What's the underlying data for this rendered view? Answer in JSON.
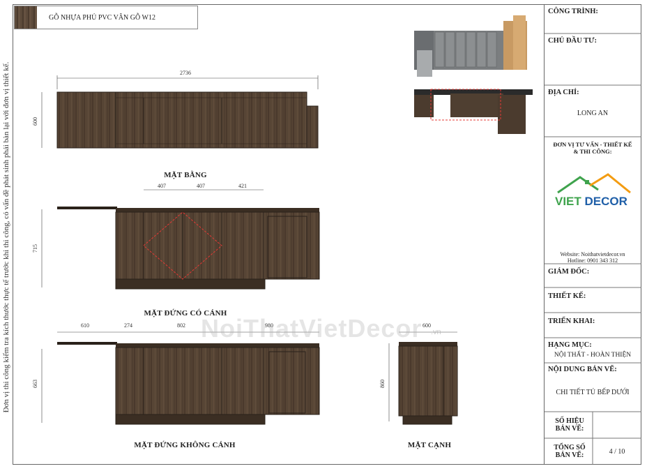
{
  "material": {
    "label": "GỖ NHỰA PHỦ PVC VÂN GỖ W12"
  },
  "side_note": "Đơn vị thi công kiểm tra kích thước thực tế trước khi thi công, có vấn đề phát sinh phải bàn lại với đơn vị thiết kế.",
  "views": {
    "plan": {
      "caption": "MẶT BẰNG",
      "width": "2736",
      "depth": "600"
    },
    "elevation_doors": {
      "caption": "MẶT ĐỨNG CÓ CÁNH",
      "height": "715",
      "widths": [
        "407",
        "407",
        "421"
      ]
    },
    "elevation_no_doors": {
      "caption": "MẶT ĐỨNG KHÔNG CÁNH",
      "height": "663",
      "widths": [
        "610",
        "274",
        "802",
        "980"
      ]
    },
    "side": {
      "caption": "MẶT CẠNH",
      "width": "600",
      "height": "860"
    }
  },
  "watermark": {
    "main": "NoiThatVietDecor",
    "suffix": ".vn"
  },
  "title_block": {
    "project_label": "CÔNG TRÌNH:",
    "investor_label": "CHỦ ĐẦU TƯ:",
    "address_label": "ĐỊA CHỈ:",
    "address_value": "LONG AN",
    "consultant_label": "ĐƠN VỊ TƯ VẤN - THIẾT KẾ & THI CÔNG:",
    "logo": {
      "viet": "VIET",
      "decor": "DECOR"
    },
    "website": "Website: Noithatvietdecor.vn",
    "hotline": "Hotline: 0901 343 312",
    "director_label": "GIÁM ĐỐC:",
    "design_label": "THIẾT KẾ:",
    "deploy_label": "TRIỂN KHAI:",
    "category_label": "HẠNG MỤC:",
    "category_value": "NỘI THẤT - HOÀN THIỆN",
    "content_label": "NỘI DUNG BẢN VẼ:",
    "content_value": "CHI TIẾT TỦ BẾP DƯỚI",
    "sheet_no_label": "SỐ HIỆU BẢN VẼ:",
    "total_label": "TỔNG SỐ BẢN VẼ:",
    "total_value": "4 / 10"
  },
  "colors": {
    "wood_dark": "#4e3f31",
    "wood_mid": "#5e4b3a",
    "outline": "#2a211a",
    "highlight": "#e53935",
    "logo_green": "#3fa34d",
    "logo_orange": "#f39c12"
  }
}
